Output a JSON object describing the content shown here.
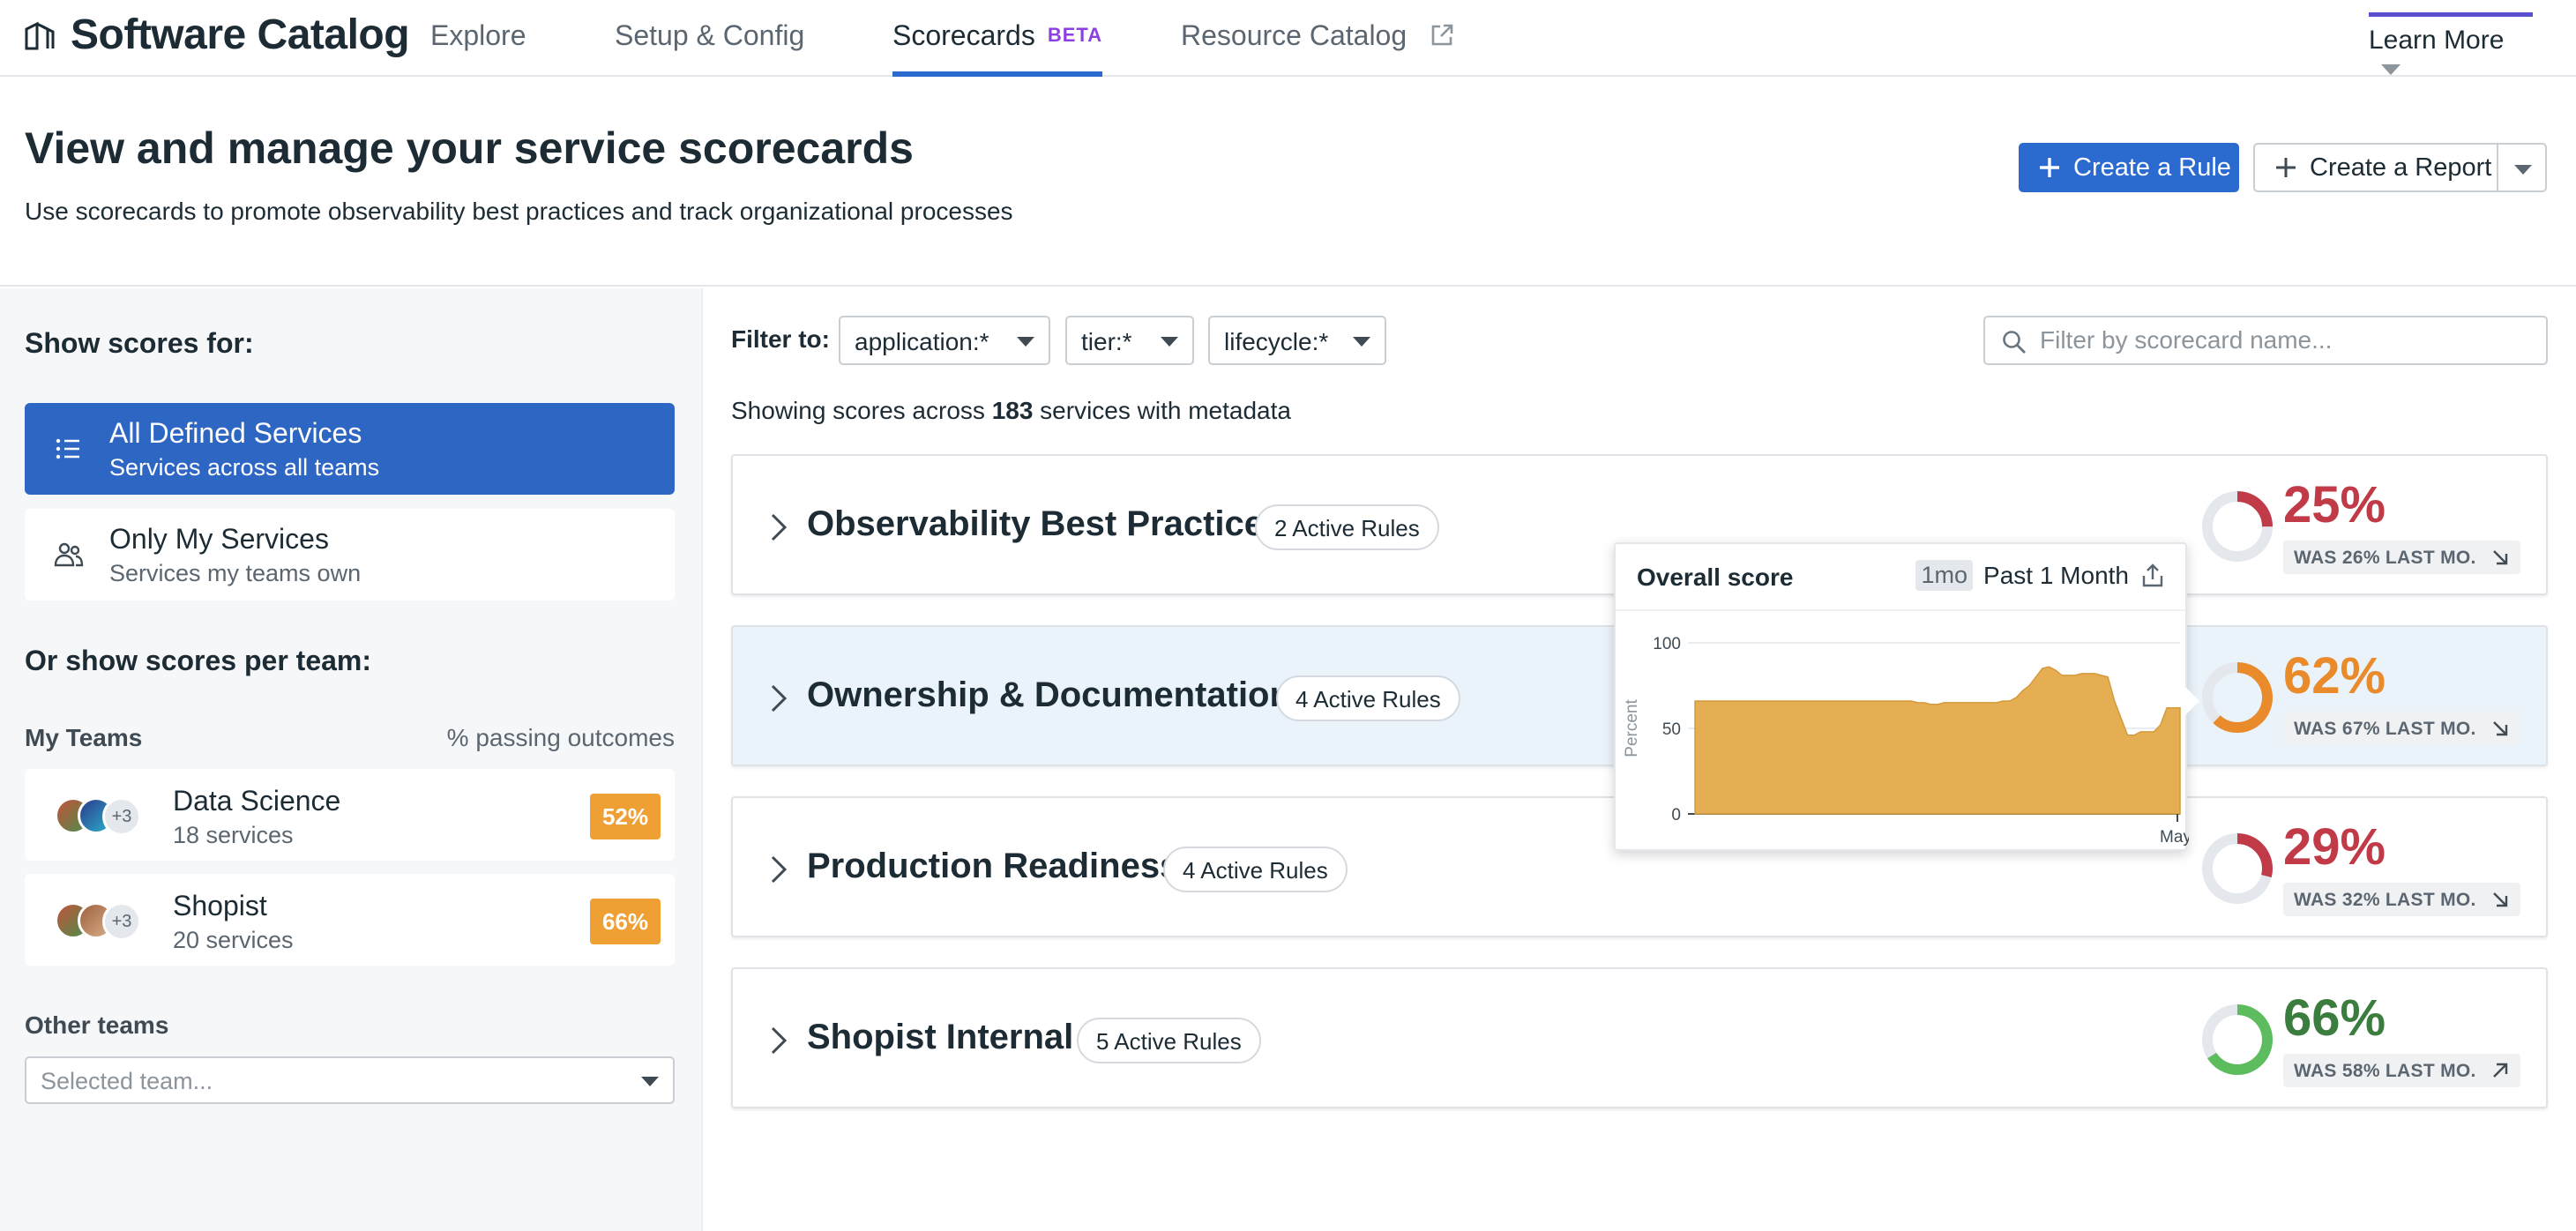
{
  "nav": {
    "app_title": "Software Catalog",
    "tabs": [
      {
        "label": "Explore"
      },
      {
        "label": "Setup & Config"
      },
      {
        "label": "Scorecards",
        "badge": "BETA",
        "active": true
      },
      {
        "label": "Resource Catalog"
      }
    ],
    "learn_more": "Learn More"
  },
  "header": {
    "title": "View and manage your service scorecards",
    "subtitle": "Use scorecards to promote observability best practices and track organizational processes",
    "create_rule": "Create a Rule",
    "create_report": "Create a Report"
  },
  "sidebar": {
    "show_scores_for": "Show scores for:",
    "scopes": [
      {
        "title": "All Defined Services",
        "subtitle": "Services across all teams",
        "active": true
      },
      {
        "title": "Only My Services",
        "subtitle": "Services my teams own",
        "active": false
      }
    ],
    "per_team_heading": "Or show scores per team:",
    "my_teams_label": "My Teams",
    "passing_label": "% passing outcomes",
    "teams": [
      {
        "name": "Data Science",
        "services": "18 services",
        "avatar_more": "+3",
        "pct": "52%"
      },
      {
        "name": "Shopist",
        "services": "20 services",
        "avatar_more": "+3",
        "pct": "66%"
      }
    ],
    "other_teams_label": "Other teams",
    "team_select_placeholder": "Selected team..."
  },
  "filters": {
    "label": "Filter to:",
    "application": "application:*",
    "tier": "tier:*",
    "lifecycle": "lifecycle:*",
    "search_placeholder": "Filter by scorecard name..."
  },
  "summary": {
    "prefix": "Showing scores across ",
    "count": "183",
    "suffix": " services with metadata"
  },
  "scorecards": [
    {
      "name": "Observability Best Practices",
      "rules": "2 Active Rules",
      "score": "25%",
      "score_value": 25,
      "was": "WAS 26% LAST MO.",
      "trend": "down",
      "color": "#c03b47"
    },
    {
      "name": "Ownership & Documentation",
      "rules": "4 Active Rules",
      "score": "62%",
      "score_value": 62,
      "was": "WAS 67% LAST MO.",
      "trend": "down",
      "color": "#e98a2b"
    },
    {
      "name": "Production Readiness",
      "rules": "4 Active Rules",
      "score": "29%",
      "score_value": 29,
      "was": "WAS 32% LAST MO.",
      "trend": "down",
      "color": "#c03b47"
    },
    {
      "name": "Shopist Internal",
      "rules": "5 Active Rules",
      "score": "66%",
      "score_value": 66,
      "was": "WAS 58% LAST MO.",
      "trend": "up",
      "color": "#3b7d3e"
    }
  ],
  "colors": {
    "primary": "#2b6acf",
    "beta": "#8c40e0",
    "orange_badge": "#eea035",
    "low_score": "#c03b47",
    "mid_score": "#e98a2b",
    "good_score": "#3b7d3e",
    "good_ring": "#5cbc5e",
    "area_fill": "#e5ae53"
  },
  "icons": {
    "brand": "catalog-icon",
    "external": "external-link-icon",
    "plus": "plus-icon",
    "list": "list-icon",
    "people": "people-icon",
    "search": "search-icon",
    "chevron": "chevron-right-icon",
    "trend_down": "arrow-down-right-icon",
    "trend_up": "arrow-up-right-icon",
    "export": "export-icon"
  },
  "tooltip": {
    "title": "Overall score",
    "range_pill": "1mo",
    "range_label": "Past 1 Month",
    "y_axis_label": "Percent",
    "y_ticks": [
      "100",
      "50",
      "0"
    ],
    "x_tick": "May"
  },
  "chart_data": {
    "type": "area",
    "title": "Overall score",
    "xlabel": "",
    "ylabel": "Percent",
    "ylim": [
      0,
      100
    ],
    "x_tick_labels": [
      "May"
    ],
    "y": [
      66,
      66,
      66,
      66,
      66,
      66,
      66,
      66,
      66,
      66,
      66,
      66,
      66,
      66,
      66,
      66,
      66,
      66,
      66,
      66,
      66,
      66,
      66,
      66,
      66,
      66,
      66,
      66,
      66,
      66,
      66,
      66,
      66,
      66,
      65,
      65,
      64,
      64,
      65,
      65,
      65,
      65,
      65,
      65,
      65,
      65,
      65,
      66,
      66,
      68,
      72,
      75,
      80,
      85,
      86,
      84,
      81,
      81,
      81,
      82,
      82,
      82,
      81,
      80,
      66,
      56,
      46,
      46,
      48,
      48,
      48,
      52,
      62,
      62,
      62
    ],
    "grid": true,
    "legend": "none"
  }
}
